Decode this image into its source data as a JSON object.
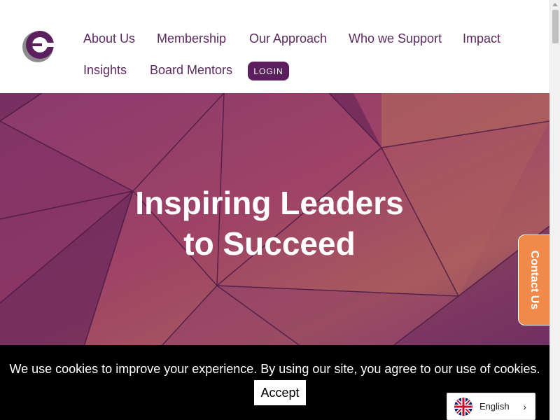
{
  "nav": {
    "items": [
      "About Us",
      "Membership",
      "Our Approach",
      "Who we Support",
      "Impact",
      "Insights",
      "Board Mentors"
    ],
    "login_label": "LOGIN"
  },
  "hero": {
    "title_line1": "Inspiring Leaders",
    "title_line2": "to Succeed"
  },
  "contact_tab": {
    "label": "Contact Us"
  },
  "cookie": {
    "message": "We use cookies to improve your experience. By using our site, you agree to our use of cookies.",
    "accept_label": "Accept"
  },
  "language": {
    "label": "English",
    "flag": "uk-flag-icon"
  },
  "colors": {
    "brand_purple": "#5c1f5e",
    "nav_text": "#5c2a5f",
    "contact_orange": "#f08a4b",
    "cookie_bg": "#000000"
  }
}
